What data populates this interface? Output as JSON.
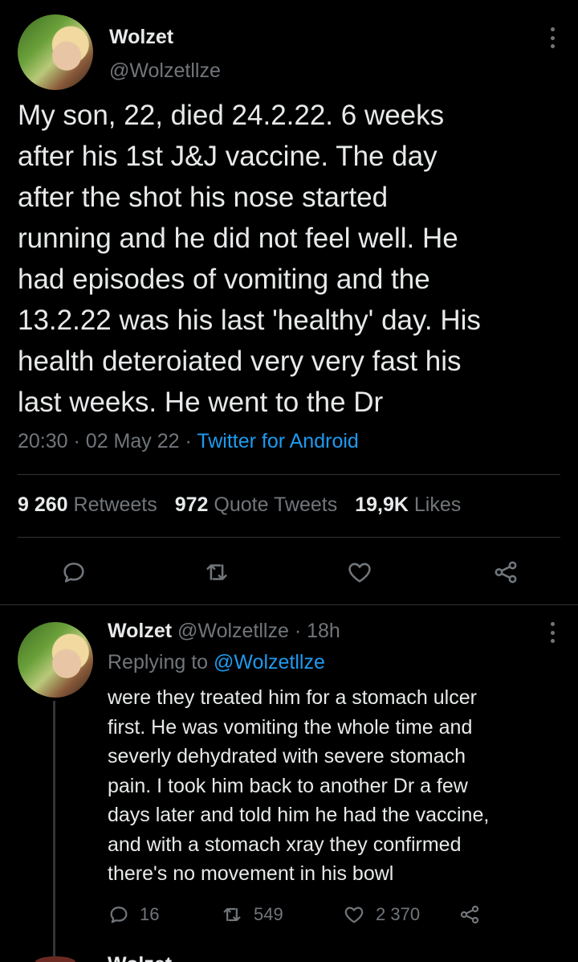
{
  "tweet": {
    "display_name": "Wolzet",
    "handle": "@Wolzetllze",
    "text": "My son, 22, died 24.2.22. 6 weeks\nafter his 1st J&J vaccine. The day\nafter the shot his nose started\nrunning and he did not feel well. He\nhad episodes of vomiting and the\n13.2.22 was his last 'healthy' day. His\nhealth deteroiated very very fast his\nlast weeks. He went to the Dr",
    "time": "20:30",
    "date": "02 May 22",
    "separator": "·",
    "source": "Twitter for Android",
    "retweets_count": "9 260",
    "retweets_label": "Retweets",
    "quotes_count": "972",
    "quotes_label": "Quote Tweets",
    "likes_count": "19,9K",
    "likes_label": "Likes"
  },
  "reply": {
    "display_name": "Wolzet",
    "handle": "@Wolzetllze",
    "age": "18h",
    "separator": "·",
    "replying_prefix": "Replying to",
    "replying_to": "@Wolzetllze",
    "text": "were they treated him for a stomach ulcer\nfirst. He was vomiting the whole time and\nseverly dehydrated with severe stomach\npain. I took him back to another Dr a few\ndays later and told him he had the vaccine,\nand with a stomach xray they confirmed\nthere's no movement in his bowl",
    "reply_count": "16",
    "retweet_count": "549",
    "like_count": "2 370"
  },
  "next_reply": {
    "partial_name": "Wolzet"
  },
  "icons": {
    "reply": "reply-icon",
    "retweet": "retweet-icon",
    "like": "heart-icon",
    "share": "share-icon",
    "more": "more-vertical-icon"
  },
  "colors": {
    "background": "#000000",
    "text": "#e7e9ea",
    "secondary": "#71767b",
    "accent": "#1d9bf0",
    "divider": "#2f3336"
  }
}
